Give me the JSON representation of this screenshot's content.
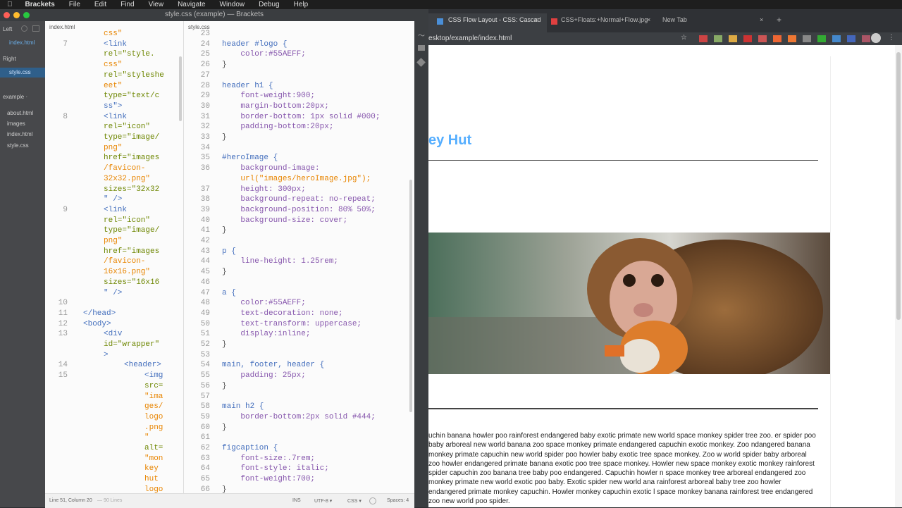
{
  "menubar": {
    "app": "Brackets",
    "items": [
      "File",
      "Edit",
      "Find",
      "View",
      "Navigate",
      "Window",
      "Debug",
      "Help"
    ]
  },
  "window": {
    "title": "style.css (example) — Brackets"
  },
  "sidebar": {
    "left_label": "Left",
    "left_file": "index.html",
    "right_label": "Right",
    "right_file": "style.css",
    "project": "example ·",
    "tree": [
      "about.html",
      "images",
      "index.html",
      "style.css"
    ]
  },
  "left_editor": {
    "tab": "index.html",
    "lines": [
      {
        "n": "",
        "t": "css\""
      },
      {
        "n": "7",
        "t": "<link"
      },
      {
        "n": "",
        "t": "rel=\"style."
      },
      {
        "n": "",
        "t": "css\""
      },
      {
        "n": "",
        "t": "rel=\"styleshe"
      },
      {
        "n": "",
        "t": "eet\""
      },
      {
        "n": "",
        "t": "type=\"text/c"
      },
      {
        "n": "",
        "t": "ss\">"
      },
      {
        "n": "8",
        "t": "<link"
      },
      {
        "n": "",
        "t": "rel=\"icon\""
      },
      {
        "n": "",
        "t": "type=\"image/"
      },
      {
        "n": "",
        "t": "png\""
      },
      {
        "n": "",
        "t": "href=\"images"
      },
      {
        "n": "",
        "t": "/favicon-"
      },
      {
        "n": "",
        "t": "32x32.png\""
      },
      {
        "n": "",
        "t": "sizes=\"32x32"
      },
      {
        "n": "",
        "t": "\" />"
      },
      {
        "n": "9",
        "t": "<link"
      },
      {
        "n": "",
        "t": "rel=\"icon\""
      },
      {
        "n": "",
        "t": "type=\"image/"
      },
      {
        "n": "",
        "t": "png\""
      },
      {
        "n": "",
        "t": "href=\"images"
      },
      {
        "n": "",
        "t": "/favicon-"
      },
      {
        "n": "",
        "t": "16x16.png\""
      },
      {
        "n": "",
        "t": "sizes=\"16x16"
      },
      {
        "n": "",
        "t": "\" />"
      },
      {
        "n": "10",
        "t": ""
      },
      {
        "n": "11",
        "t": "</head>"
      },
      {
        "n": "12",
        "t": "<body>"
      },
      {
        "n": "13",
        "t": "<div"
      },
      {
        "n": "",
        "t": "id=\"wrapper\""
      },
      {
        "n": "",
        "t": ">"
      },
      {
        "n": "14",
        "t": "<header>"
      },
      {
        "n": "15",
        "t": "<img"
      },
      {
        "n": "",
        "t": "src="
      },
      {
        "n": "",
        "t": "\"ima"
      },
      {
        "n": "",
        "t": "ges/"
      },
      {
        "n": "",
        "t": "logo"
      },
      {
        "n": "",
        "t": ".png"
      },
      {
        "n": "",
        "t": "\""
      },
      {
        "n": "",
        "t": "alt="
      },
      {
        "n": "",
        "t": "\"mon"
      },
      {
        "n": "",
        "t": "key"
      },
      {
        "n": "",
        "t": "hut"
      },
      {
        "n": "",
        "t": "logo"
      }
    ]
  },
  "right_editor": {
    "tab": "style.css",
    "lines": [
      {
        "n": "23",
        "t": ""
      },
      {
        "n": "24",
        "t": "header #logo {"
      },
      {
        "n": "25",
        "t": "    color:#55AEFF;"
      },
      {
        "n": "26",
        "t": "}"
      },
      {
        "n": "27",
        "t": ""
      },
      {
        "n": "28",
        "t": "header h1 {"
      },
      {
        "n": "29",
        "t": "    font-weight:900;"
      },
      {
        "n": "30",
        "t": "    margin-bottom:20px;"
      },
      {
        "n": "31",
        "t": "    border-bottom: 1px solid #000;"
      },
      {
        "n": "32",
        "t": "    padding-bottom:20px;"
      },
      {
        "n": "33",
        "t": "}"
      },
      {
        "n": "34",
        "t": ""
      },
      {
        "n": "35",
        "t": "#heroImage {"
      },
      {
        "n": "36",
        "t": "    background-image:"
      },
      {
        "n": "",
        "t": "    url(\"images/heroImage.jpg\");"
      },
      {
        "n": "37",
        "t": "    height: 300px;"
      },
      {
        "n": "38",
        "t": "    background-repeat: no-repeat;"
      },
      {
        "n": "39",
        "t": "    background-position: 80% 50%;"
      },
      {
        "n": "40",
        "t": "    background-size: cover;"
      },
      {
        "n": "41",
        "t": "}"
      },
      {
        "n": "42",
        "t": ""
      },
      {
        "n": "43",
        "t": "p {"
      },
      {
        "n": "44",
        "t": "    line-height: 1.25rem;"
      },
      {
        "n": "45",
        "t": "}"
      },
      {
        "n": "46",
        "t": ""
      },
      {
        "n": "47",
        "t": "a {"
      },
      {
        "n": "48",
        "t": "    color:#55AEFF;"
      },
      {
        "n": "49",
        "t": "    text-decoration: none;"
      },
      {
        "n": "50",
        "t": "    text-transform: uppercase;"
      },
      {
        "n": "51",
        "t": "    display:inline;"
      },
      {
        "n": "52",
        "t": "}"
      },
      {
        "n": "53",
        "t": ""
      },
      {
        "n": "54",
        "t": "main, footer, header {"
      },
      {
        "n": "55",
        "t": "    padding: 25px;"
      },
      {
        "n": "56",
        "t": "}"
      },
      {
        "n": "57",
        "t": ""
      },
      {
        "n": "58",
        "t": "main h2 {"
      },
      {
        "n": "59",
        "t": "    border-bottom:2px solid #444;"
      },
      {
        "n": "60",
        "t": "}"
      },
      {
        "n": "61",
        "t": ""
      },
      {
        "n": "62",
        "t": "figcaption {"
      },
      {
        "n": "63",
        "t": "    font-size:.7rem;"
      },
      {
        "n": "64",
        "t": "    font-style: italic;"
      },
      {
        "n": "65",
        "t": "    font-weight:700;"
      },
      {
        "n": "66",
        "t": "}"
      }
    ]
  },
  "statusbar": {
    "position": "Line 51, Column 20",
    "lines": "— 90 Lines",
    "mode": "INS",
    "encoding": "UTF-8 ▾",
    "language": "CSS ▾",
    "spaces": "Spaces: 4"
  },
  "browser": {
    "tabs": [
      "CSS Flow Layout - CSS: Cascad",
      "CSS+Floats:+Normal+Flow.jpg",
      "New Tab"
    ],
    "url": "esktop/example/index.html",
    "logo_text": "ey Hut",
    "paragraph": "uchin banana howler poo rainforest endangered baby exotic primate new world space monkey spider tree zoo. er spider poo baby arboreal new world banana zoo space monkey primate endangered capuchin exotic monkey. Zoo ndangered banana monkey primate capuchin new world spider poo howler baby exotic tree space monkey. Zoo w world spider baby arboreal zoo howler endangered primate banana exotic poo tree space monkey. Howler new space monkey exotic monkey rainforest spider capuchin zoo banana tree baby poo endangered. Capuchin howler n space monkey tree arboreal endangered zoo monkey primate new world exotic poo baby. Exotic spider new world ana rainforest arboreal baby tree zoo howler endangered primate monkey capuchin. Howler monkey capuchin exotic l space monkey banana rainforest tree endangered zoo new world poo spider."
  },
  "colors": {
    "accent": "#55AEFF",
    "selection": "#2f5f8a"
  }
}
